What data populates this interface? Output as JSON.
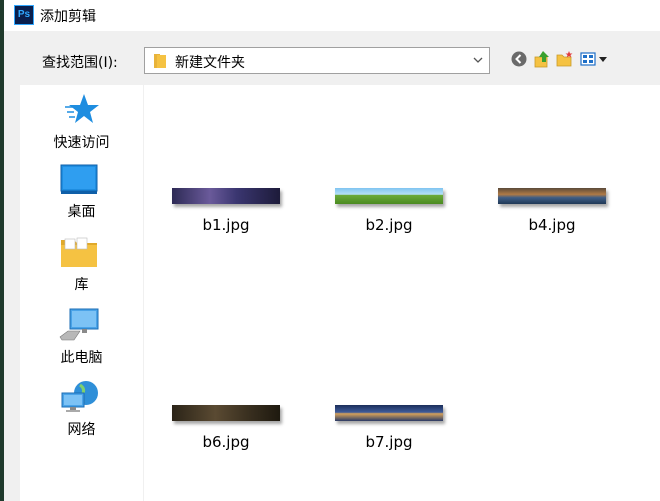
{
  "window": {
    "title": "添加剪辑",
    "app_icon_text": "Ps"
  },
  "lookin": {
    "label": "查找范围(I):",
    "value": "新建文件夹"
  },
  "toolbar": {
    "icons": [
      "back-icon",
      "up-folder-icon",
      "new-folder-icon",
      "view-menu-icon"
    ]
  },
  "places": [
    {
      "id": "quick-access",
      "label": "快速访问",
      "icon": "star-icon"
    },
    {
      "id": "desktop",
      "label": "桌面",
      "icon": "desktop-icon"
    },
    {
      "id": "library",
      "label": "库",
      "icon": "library-icon"
    },
    {
      "id": "this-pc",
      "label": "此电脑",
      "icon": "computer-icon"
    },
    {
      "id": "network",
      "label": "网络",
      "icon": "network-icon"
    }
  ],
  "files": [
    {
      "name": "b1.jpg"
    },
    {
      "name": "b2.jpg"
    },
    {
      "name": "b4.jpg"
    },
    {
      "name": "b6.jpg"
    },
    {
      "name": "b7.jpg"
    }
  ],
  "colors": {
    "accent": "#1e8de0",
    "folder": "#f5c242",
    "ps_dark": "#0a1f4d",
    "ps_blue": "#31a8ff"
  }
}
